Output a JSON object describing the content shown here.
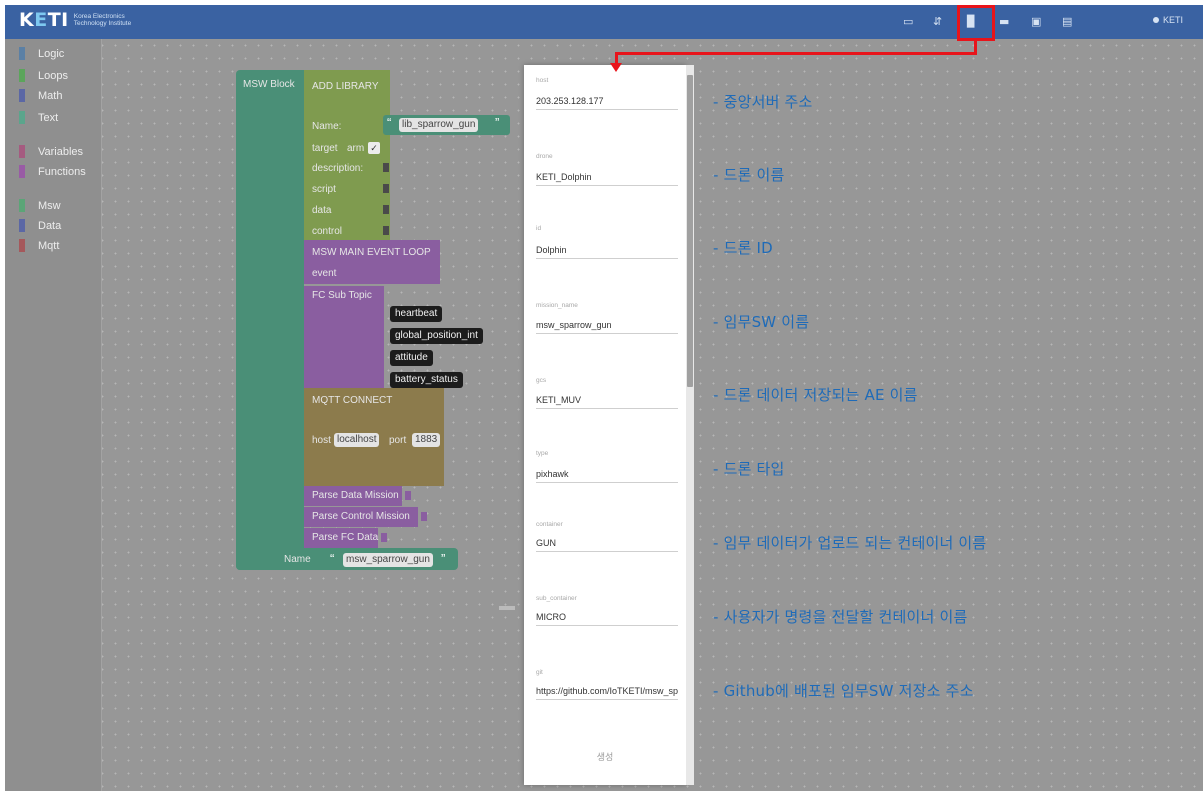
{
  "colors": {
    "accent": "#3a62a2",
    "highlight": "#e8141b",
    "description_text": "#1f6bb8"
  },
  "header": {
    "logo_text_left": "K",
    "logo_text_e": "E",
    "logo_text_right": "TI",
    "logo_subtitle_1": "Korea Electronics",
    "logo_subtitle_2": "Technology Institute",
    "icons": [
      "image-icon",
      "export-icon",
      "new-file-icon",
      "open-folder-icon",
      "save-icon",
      "save-as-icon"
    ],
    "user": "KETI"
  },
  "toolbox": {
    "categories": [
      {
        "label": "Logic",
        "color": "#5b80a5"
      },
      {
        "label": "Loops",
        "color": "#5ba55b"
      },
      {
        "label": "Math",
        "color": "#5b67a5"
      },
      {
        "label": "Text",
        "color": "#5ba58c"
      },
      {
        "label": "Variables",
        "color": "#a55b80"
      },
      {
        "label": "Functions",
        "color": "#995ba5"
      },
      {
        "label": "Msw",
        "color": "#5ba577"
      },
      {
        "label": "Data",
        "color": "#5b67a5"
      },
      {
        "label": "Mqtt",
        "color": "#a5585b"
      }
    ]
  },
  "blocks": {
    "msw_block": "MSW Block",
    "add_library": "ADD LIBRARY",
    "name_label": "Name:",
    "name_value": "lib_sparrow_gun",
    "target_label": "target",
    "target_value": "arm",
    "description_label": "description:",
    "script_label": "script",
    "data_label": "data",
    "control_label": "control",
    "main_event_loop": "MSW MAIN EVENT LOOP",
    "event_label": "event",
    "fc_sub_topic": "FC Sub Topic",
    "topics": [
      "heartbeat",
      "global_position_int",
      "attitude",
      "battery_status"
    ],
    "mqtt_connect": "MQTT CONNECT",
    "host_label": "host",
    "host_value": "localhost",
    "port_label": "port",
    "port_value": "1883",
    "parse_data": "Parse Data Mission",
    "parse_control": "Parse Control Mission",
    "parse_fc": "Parse FC Data",
    "bottom_name_label": "Name",
    "bottom_name_value": "msw_sparrow_gun",
    "quote_open": "“",
    "quote_close": "”"
  },
  "form": {
    "fields": [
      {
        "label": "host",
        "value": "203.253.128.177"
      },
      {
        "label": "drone",
        "value": "KETI_Dolphin"
      },
      {
        "label": "id",
        "value": "Dolphin"
      },
      {
        "label": "mission_name",
        "value": "msw_sparrow_gun"
      },
      {
        "label": "gcs",
        "value": "KETI_MUV"
      },
      {
        "label": "type",
        "value": "pixhawk"
      },
      {
        "label": "container",
        "value": "GUN"
      },
      {
        "label": "sub_container",
        "value": "MICRO"
      },
      {
        "label": "git",
        "value": "https://github.com/IoTKETI/msw_sparrow_gun"
      }
    ],
    "create_button": "생성"
  },
  "descriptions": [
    "- 중앙서버 주소",
    "- 드론 이름",
    "- 드론 ID",
    "- 임무SW 이름",
    "- 드론 데이터 저장되는 AE 이름",
    "- 드론 타입",
    "- 임무 데이터가 업로드 되는 컨테이너 이름",
    "- 사용자가 명령을 전달할 컨테이너 이름",
    "- Github에 배포된 임무SW 저장소 주소"
  ]
}
